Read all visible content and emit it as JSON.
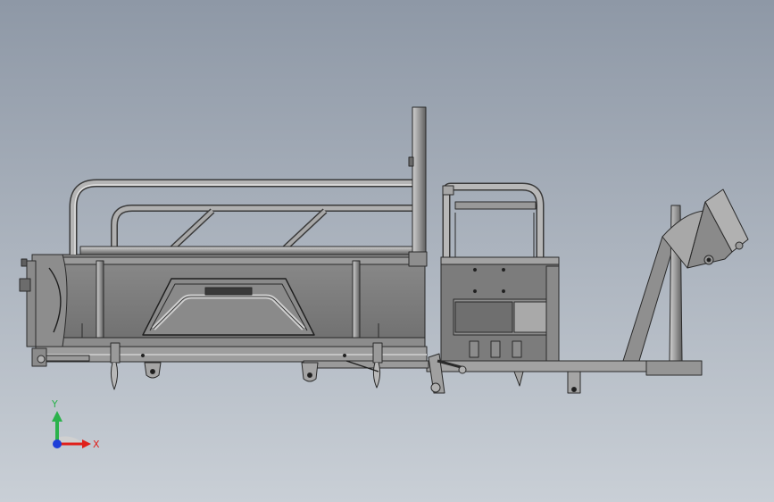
{
  "viewport": {
    "background_top": "#8e98a6",
    "background_bottom": "#c9cfd6"
  },
  "model": {
    "view": "side-elevation",
    "metal_fill": "#7f7f7f",
    "metal_light": "#b4b4b4",
    "line_color": "#2a2a2a"
  },
  "triad": {
    "y_label": "Y",
    "x_label": "X",
    "y_color": "#2bb24c",
    "x_color": "#e0201b",
    "z_color": "#1f3fd8"
  }
}
